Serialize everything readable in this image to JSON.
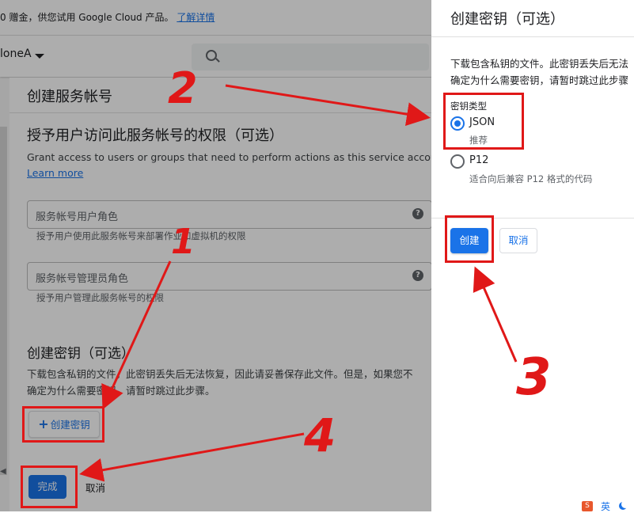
{
  "background": {
    "banner_text": "0 赠金，供您试用 Google Cloud 产品。",
    "banner_link": "了解详情",
    "project_name": "loneA",
    "page_title": "创建服务帐号",
    "grant_section": {
      "title": "授予用户访问此服务帐号的权限（可选）",
      "description": "Grant access to users or groups that need to perform actions as this service account.",
      "learn_more": "Learn more",
      "fields": [
        {
          "placeholder": "服务帐号用户角色",
          "hint": "授予用户使用此服务帐号来部署作业和虚拟机的权限"
        },
        {
          "placeholder": "服务帐号管理员角色",
          "hint": "授予用户管理此服务帐号的权限"
        }
      ]
    },
    "key_section": {
      "title": "创建密钥（可选）",
      "description_line1": "下载包含私钥的文件。此密钥丢失后无法恢复，因此请妥善保存此文件。但是，如果您不",
      "description_line2": "确定为什么需要密钥，请暂时跳过此步骤。",
      "create_key_button": "创建密钥"
    },
    "done_button": "完成",
    "cancel_button": "取消"
  },
  "panel": {
    "title": "创建密钥（可选）",
    "description_line1": "下载包含私钥的文件。此密钥丢失后无法",
    "description_line2": "确定为什么需要密钥，请暂时跳过此步骤",
    "key_type_label": "密钥类型",
    "options": [
      {
        "label": "JSON",
        "sub": "推荐",
        "selected": true
      },
      {
        "label": "P12",
        "sub": "适合向后兼容 P12 格式的代码",
        "selected": false
      }
    ],
    "create_button": "创建",
    "cancel_button": "取消"
  },
  "ime": {
    "lang": "英"
  },
  "annotations": {
    "labels": [
      "1",
      "2",
      "3",
      "4"
    ],
    "color": "#e01818"
  },
  "colors": {
    "primary": "#1a73e8",
    "annotation_red": "#e01818"
  }
}
